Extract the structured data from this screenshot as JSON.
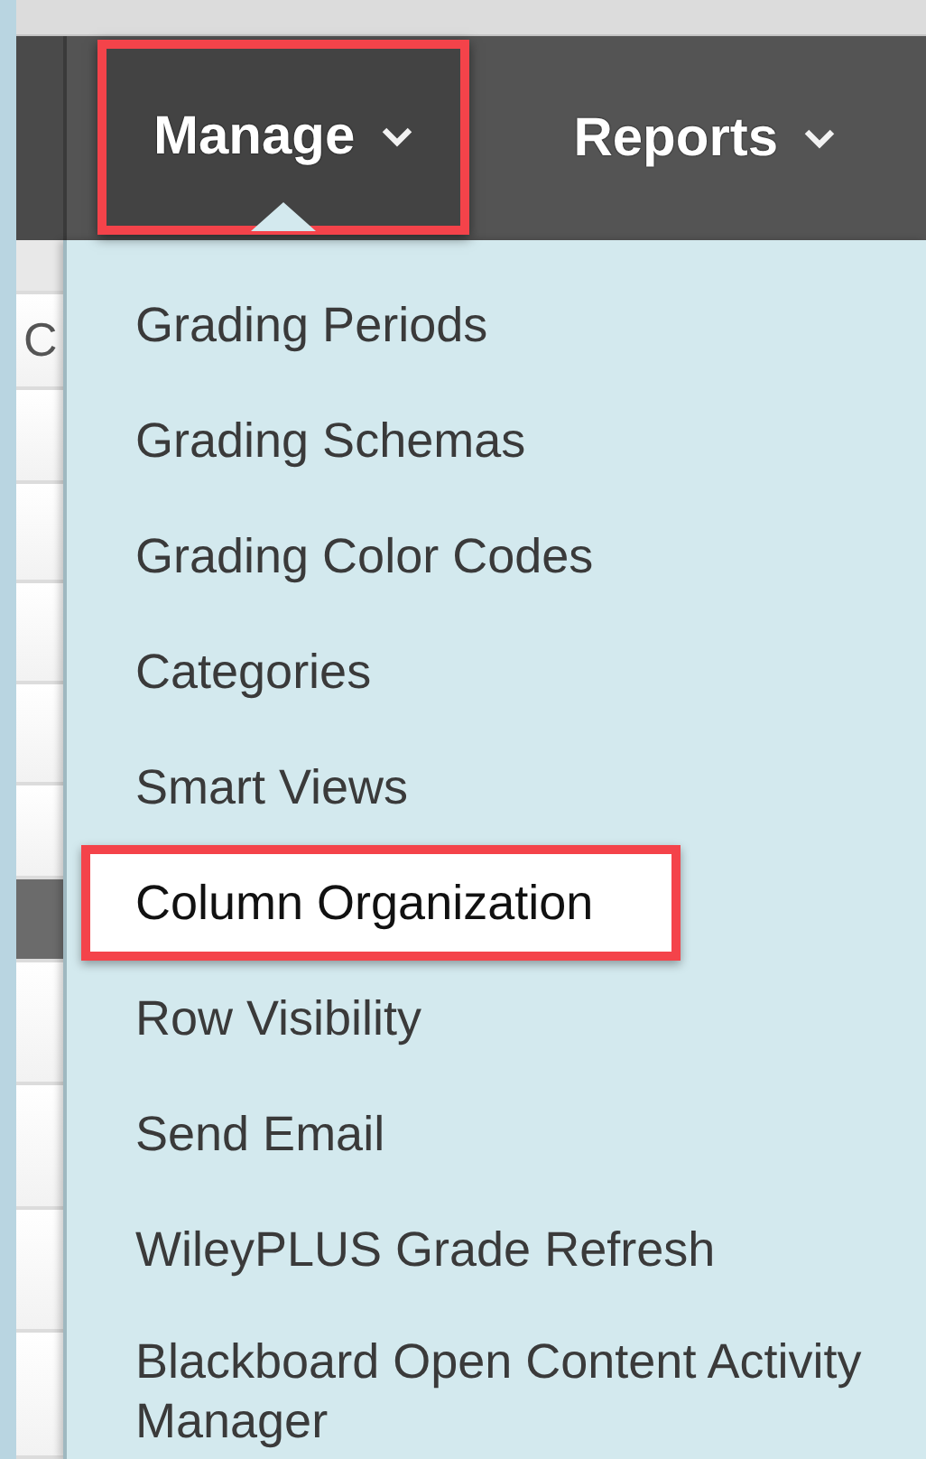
{
  "nav": [
    {
      "label": "Manage",
      "open": true
    },
    {
      "label": "Reports",
      "open": false
    }
  ],
  "background_table": {
    "header": "C"
  },
  "menu": [
    {
      "label": "Grading Periods",
      "selected": false
    },
    {
      "label": "Grading Schemas",
      "selected": false
    },
    {
      "label": "Grading Color Codes",
      "selected": false
    },
    {
      "label": "Categories",
      "selected": false
    },
    {
      "label": "Smart Views",
      "selected": false
    },
    {
      "label": "Column Organization",
      "selected": true
    },
    {
      "label": "Row Visibility",
      "selected": false
    },
    {
      "label": "Send Email",
      "selected": false
    },
    {
      "label": "WileyPLUS Grade Refresh",
      "selected": false
    },
    {
      "label": "Blackboard Open Content Activity Manager",
      "selected": false
    }
  ]
}
